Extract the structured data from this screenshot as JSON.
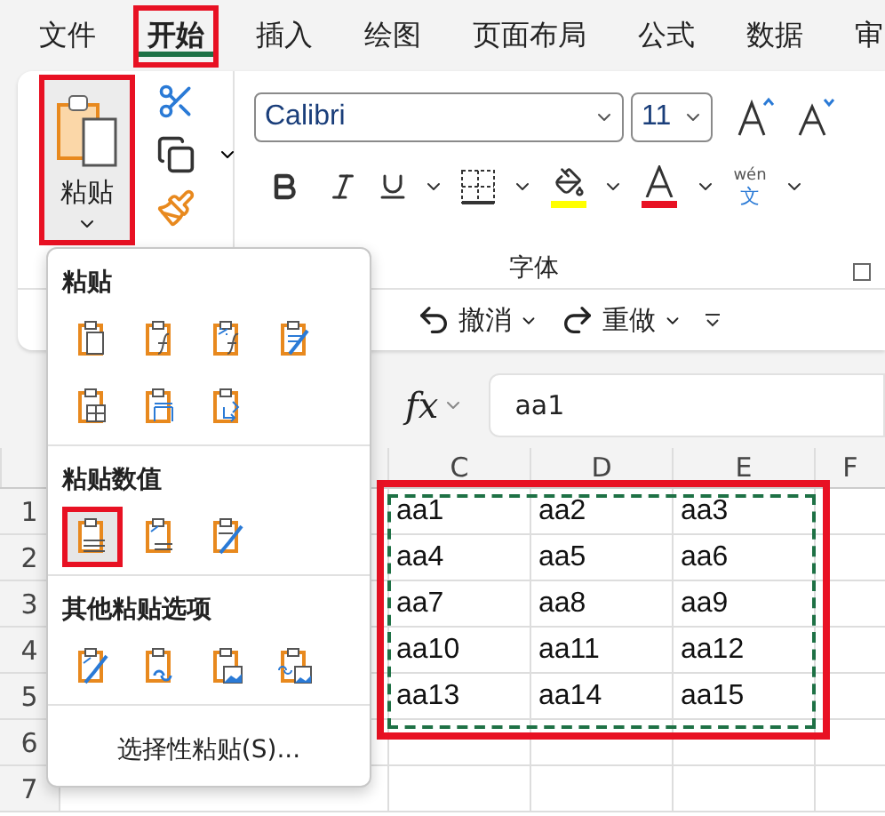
{
  "tabs": [
    {
      "label": "文件",
      "selected": false,
      "highlighted": false
    },
    {
      "label": "开始",
      "selected": true,
      "highlighted": true
    },
    {
      "label": "插入",
      "selected": false,
      "highlighted": false
    },
    {
      "label": "绘图",
      "selected": false,
      "highlighted": false
    },
    {
      "label": "页面布局",
      "selected": false,
      "highlighted": false
    },
    {
      "label": "公式",
      "selected": false,
      "highlighted": false
    },
    {
      "label": "数据",
      "selected": false,
      "highlighted": false
    },
    {
      "label": "审",
      "selected": false,
      "highlighted": false
    }
  ],
  "ribbon": {
    "paste_button": {
      "label": "粘贴",
      "highlighted": true
    },
    "font_name": "Calibri",
    "font_size": "11",
    "phonetic": {
      "top": "wén",
      "bottom": "文"
    },
    "group_label": "字体"
  },
  "quick_access": [
    {
      "kind": "undo",
      "label": "撤消"
    },
    {
      "kind": "redo",
      "label": "重做"
    }
  ],
  "formula_bar": {
    "fx": "fx",
    "value": "aa1"
  },
  "sheet": {
    "columns": [
      "C",
      "D",
      "E",
      "F"
    ],
    "row_numbers": [
      "1",
      "2",
      "3",
      "4",
      "5",
      "6",
      "7"
    ],
    "highlighted": true,
    "rows": [
      [
        "aa1",
        "aa2",
        "aa3"
      ],
      [
        "aa4",
        "aa5",
        "aa6"
      ],
      [
        "aa7",
        "aa8",
        "aa9"
      ],
      [
        "aa10",
        "aa11",
        "aa12"
      ],
      [
        "aa13",
        "aa14",
        "aa15"
      ]
    ]
  },
  "paste_menu": {
    "sections": [
      {
        "title": "粘贴",
        "options": [
          {
            "kind": "doc",
            "selected": false,
            "highlighted": false
          },
          {
            "kind": "formula",
            "selected": false,
            "highlighted": false
          },
          {
            "kind": "formula-format",
            "selected": false,
            "highlighted": false
          },
          {
            "kind": "brush",
            "selected": false,
            "highlighted": false
          },
          {
            "kind": "grid",
            "selected": false,
            "highlighted": false
          },
          {
            "kind": "width",
            "selected": false,
            "highlighted": false
          },
          {
            "kind": "transpose",
            "selected": false,
            "highlighted": false
          }
        ]
      },
      {
        "title": "粘贴数值",
        "options": [
          {
            "kind": "values",
            "selected": true,
            "highlighted": true
          },
          {
            "kind": "values-format",
            "selected": false,
            "highlighted": false
          },
          {
            "kind": "values-brush",
            "selected": false,
            "highlighted": false
          }
        ]
      },
      {
        "title": "其他粘贴选项",
        "options": [
          {
            "kind": "format-brush",
            "selected": false,
            "highlighted": false
          },
          {
            "kind": "link",
            "selected": false,
            "highlighted": false
          },
          {
            "kind": "picture",
            "selected": false,
            "highlighted": false
          },
          {
            "kind": "linked-picture",
            "selected": false,
            "highlighted": false
          }
        ]
      }
    ],
    "footer": "选择性粘贴(S)..."
  }
}
